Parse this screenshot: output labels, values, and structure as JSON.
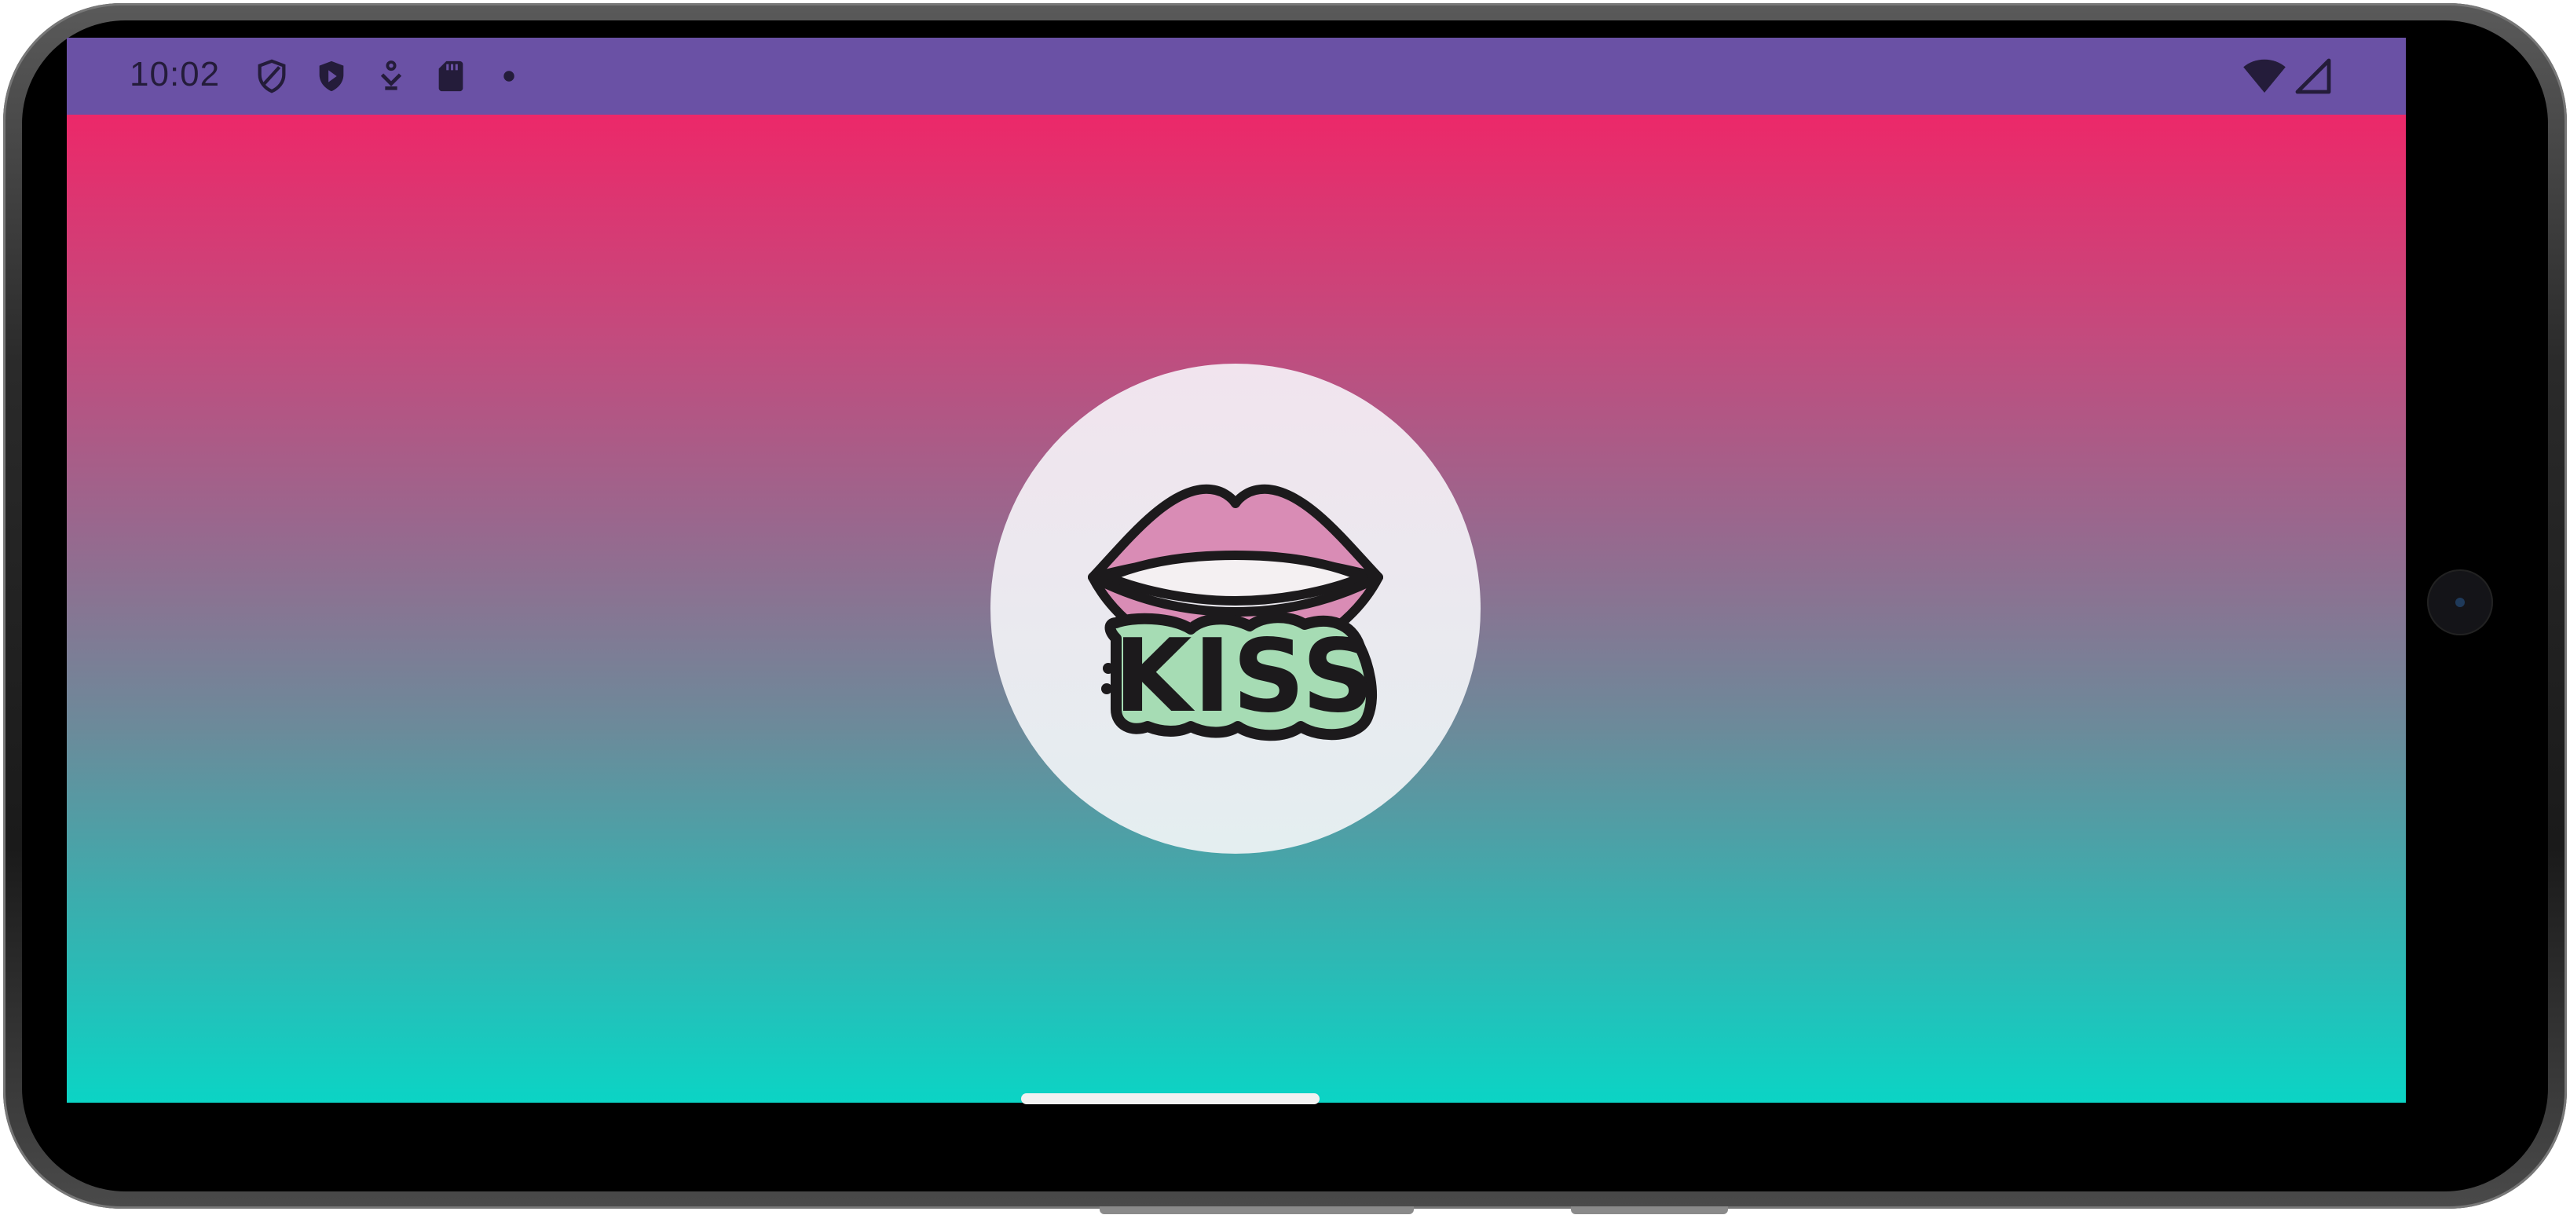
{
  "status_bar": {
    "time": "10:02",
    "left_icons": [
      "shield-outline-icon",
      "shield-play-icon",
      "download-assistant-icon",
      "sd-card-icon",
      "dot-icon"
    ],
    "right_icons": [
      "wifi-icon",
      "cell-signal-icon"
    ],
    "background_color": "#6a51a5"
  },
  "app": {
    "logo_text": "KISS",
    "logo_icon": "lips-icon",
    "gradient_top": "#ec2869",
    "gradient_bottom": "#0bd4c5"
  },
  "navigation": {
    "home_indicator": "home-pill"
  }
}
